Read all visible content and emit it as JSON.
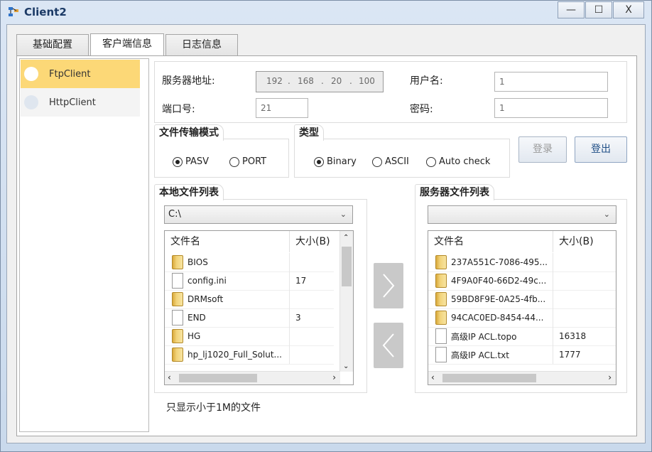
{
  "window": {
    "title": "Client2",
    "minimize": "—",
    "maximize": "☐",
    "close": "X"
  },
  "tabs": [
    {
      "label": "基础配置"
    },
    {
      "label": "客户端信息"
    },
    {
      "label": "日志信息"
    }
  ],
  "sidebar": {
    "items": [
      {
        "label": "FtpClient"
      },
      {
        "label": "HttpClient"
      }
    ]
  },
  "server_address": {
    "label": "服务器地址:",
    "ip": [
      "192",
      "168",
      "20",
      "100"
    ]
  },
  "username": {
    "label": "用户名:",
    "value": "1"
  },
  "port": {
    "label": "端口号:",
    "value": "21"
  },
  "password": {
    "label": "密码:",
    "value": "1"
  },
  "transfer_mode": {
    "title": "文件传输模式",
    "options": [
      "PASV",
      "PORT"
    ],
    "selected": "PASV"
  },
  "type": {
    "title": "类型",
    "options": [
      "Binary",
      "ASCII",
      "Auto check"
    ],
    "selected": "Binary"
  },
  "buttons": {
    "login": "登录",
    "logout": "登出"
  },
  "local_list": {
    "title": "本地文件列表",
    "path": "C:\\",
    "headers": [
      "文件名",
      "大小(B)"
    ],
    "rows": [
      {
        "name": "BIOS",
        "size": "",
        "icon": "folder-icon"
      },
      {
        "name": "config.ini",
        "size": "17",
        "icon": "file-icon"
      },
      {
        "name": "DRMsoft",
        "size": "",
        "icon": "folder-icon"
      },
      {
        "name": "END",
        "size": "3",
        "icon": "file-icon"
      },
      {
        "name": "HG",
        "size": "",
        "icon": "folder-icon"
      },
      {
        "name": "hp_lj1020_Full_Solut...",
        "size": "",
        "icon": "folder-icon"
      }
    ]
  },
  "server_list": {
    "title": "服务器文件列表",
    "path": "",
    "headers": [
      "文件名",
      "大小(B)"
    ],
    "rows": [
      {
        "name": "237A551C-7086-495...",
        "size": "",
        "icon": "folder-icon"
      },
      {
        "name": "4F9A0F40-66D2-49c...",
        "size": "",
        "icon": "folder-icon"
      },
      {
        "name": "59BD8F9E-0A25-4fb...",
        "size": "",
        "icon": "folder-icon"
      },
      {
        "name": "94CAC0ED-8454-44...",
        "size": "",
        "icon": "folder-icon"
      },
      {
        "name": "高级IP ACL.topo",
        "size": "16318",
        "icon": "file-icon"
      },
      {
        "name": "高级IP ACL.txt",
        "size": "1777",
        "icon": "file-icon"
      }
    ]
  },
  "footer_note": "只显示小于1M的文件",
  "colors": {
    "selected_item": "#fcd877",
    "accent": "#1b3a66"
  }
}
